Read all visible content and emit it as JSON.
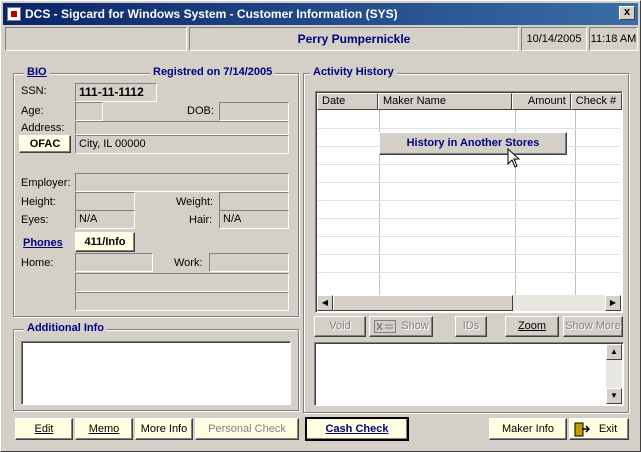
{
  "window": {
    "title": "DCS - Sigcard for Windows System - Customer Information (SYS)",
    "close_label": "x"
  },
  "header": {
    "customer_name": "Perry Pumpernickle",
    "date": "10/14/2005",
    "time": "11:18 AM"
  },
  "bio": {
    "legend": "BIO",
    "registered_label": "Registred on 7/14/2005",
    "ssn_label": "SSN:",
    "ssn_value": "111-11-1112",
    "age_label": "Age:",
    "age_value": "",
    "dob_label": "DOB:",
    "dob_value": "",
    "address_label": "Address:",
    "address_line1": "",
    "address_line2": "City, IL 00000",
    "ofac_button": "OFAC",
    "employer_label": "Employer:",
    "employer_value": "",
    "height_label": "Height:",
    "height_value": "",
    "weight_label": "Weight:",
    "weight_value": "",
    "eyes_label": "Eyes:",
    "eyes_value": "N/A",
    "hair_label": "Hair:",
    "hair_value": "N/A",
    "phones_label": "Phones",
    "info411_button": "411/Info",
    "home_label": "Home:",
    "home_value": "",
    "work_label": "Work:",
    "work_value": "",
    "extra_phone1": "",
    "extra_phone2": ""
  },
  "additional_info": {
    "legend": "Additional Info",
    "text": ""
  },
  "activity_history": {
    "legend": "Activity History",
    "columns": [
      "Date",
      "Maker Name",
      "Amount",
      "Check #"
    ],
    "rows": [],
    "history_button": "History in Another Stores",
    "buttons": {
      "void": "Void",
      "show": "Show",
      "ids": "IDs",
      "zoom": "Zoom",
      "show_more": "Show More"
    },
    "notes_text": ""
  },
  "footer": {
    "edit": "Edit",
    "memo": "Memo",
    "more_info": "More Info",
    "personal_check": "Personal Check",
    "cash_check": "Cash Check",
    "maker_info": "Maker Info",
    "exit": "Exit"
  },
  "colors": {
    "title_bar": "#0a246a",
    "accent_text": "#000080",
    "button_face": "#d4d0c8",
    "highlight_button": "#ffffe1"
  }
}
